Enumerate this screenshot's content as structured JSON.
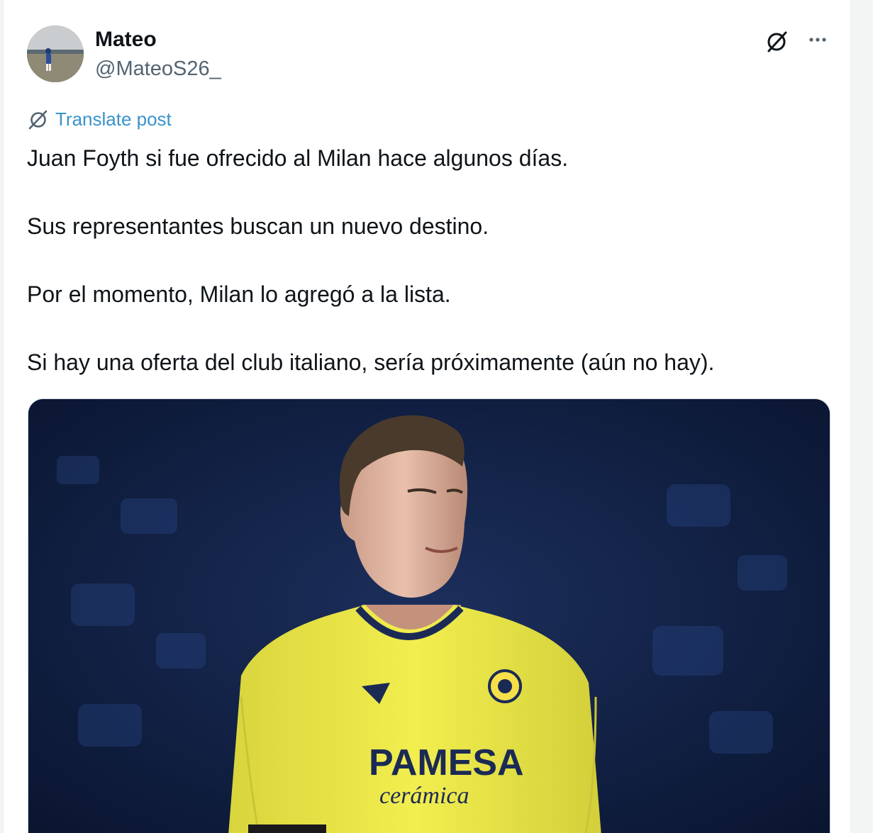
{
  "post": {
    "author_name": "Mateo",
    "author_handle": "@MateoS26_",
    "translate_label": "Translate post",
    "paragraphs": [
      "Juan Foyth si fue ofrecido al Milan hace algunos días.",
      "Sus representantes buscan un nuevo destino.",
      "Por el momento, Milan lo agregó a la lista.",
      "Si hay una oferta del club italiano, sería próximamente (aún no hay)."
    ],
    "media": {
      "shirt_sponsor": "PAMESA",
      "shirt_sponsor_sub": "cerámica"
    }
  },
  "icons": {
    "translate": "grok-translate-icon",
    "grok": "grok-icon",
    "more": "more-options-icon"
  },
  "colors": {
    "link": "#3a93c9",
    "text": "#0f1419",
    "muted": "#536471",
    "shirt_yellow": "#f2ee4f"
  }
}
